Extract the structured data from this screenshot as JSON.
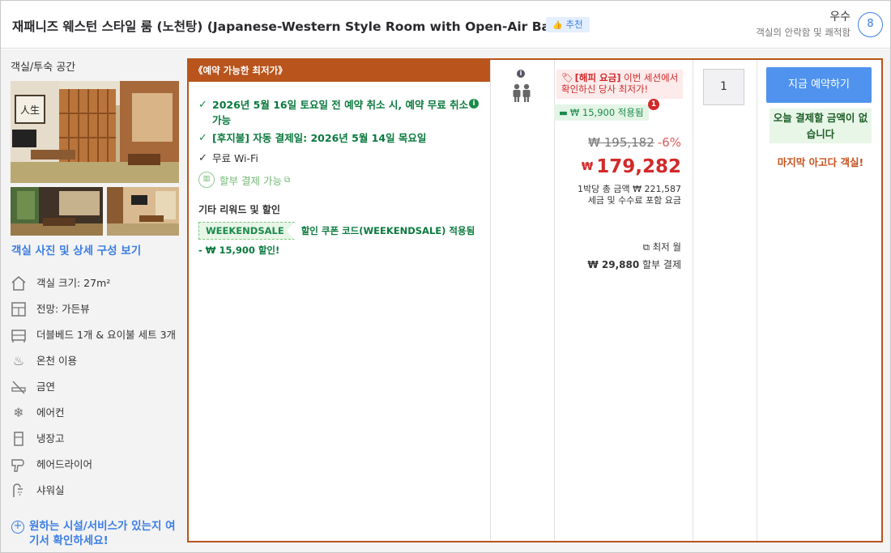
{
  "header": {
    "room_title": "재패니즈 웨스턴 스타일 룸 (노천탕) (Japanese-Western Style Room with Open-Air Bath)",
    "recommend_label": "추천",
    "rating_word": "우수",
    "rating_sub": "객실의 안락함 및 쾌적함",
    "rating_score": "8"
  },
  "left": {
    "heading": "객실/투숙 공간",
    "photos_link": "객실 사진 및 상세 구성 보기",
    "amenities": [
      {
        "icon": "house-icon",
        "label": "객실 크기: 27m²"
      },
      {
        "icon": "window-view-icon",
        "label": "전망: 가든뷰"
      },
      {
        "icon": "bed-icon",
        "label": "더블베드 1개 & 요이불 세트 3개"
      },
      {
        "icon": "hot-spring-icon",
        "label": "온천 이용"
      },
      {
        "icon": "no-smoking-icon",
        "label": "금연"
      },
      {
        "icon": "snowflake-icon",
        "label": "에어컨"
      },
      {
        "icon": "fridge-icon",
        "label": "냉장고"
      },
      {
        "icon": "hair-dryer-icon",
        "label": "헤어드라이어"
      },
      {
        "icon": "shower-icon",
        "label": "샤워실"
      }
    ],
    "more_link": "원하는 시설/서비스가 있는지 여기서 확인하세요!"
  },
  "offer": {
    "banner": "《예약 가능한 최저가》",
    "benefit_1": "2026년 5월 16일 토요일 전 예약 취소 시, 예약 무료 취소 가능",
    "benefit_2": "[후지불] 자동 결제일: 2026년 5월 14일 목요일",
    "benefit_3": "무료 Wi-Fi",
    "installment": "할부 결제 가능",
    "other_title": "기타 리워드 및 할인",
    "coupon_code": "WEEKENDSALE",
    "coupon_text": "할인 쿠폰 코드(WEEKENDSALE) 적용됨",
    "coupon_discount": "- ₩ 15,900 할인!"
  },
  "price": {
    "promo_label": "[해피 요금]",
    "promo_text": "이번 세션에서 확인하신 당사 최저가!",
    "saved": "₩ 15,900 적용됨",
    "saved_badge": "1",
    "original": "₩ 195,182",
    "discount_pct": "-6%",
    "currency": "₩",
    "final": "179,282",
    "per_night": "1박당 총 금액 ₩ 221,587",
    "tax_note": "세금 및 수수료 포함 요금",
    "lowest_monthly": "최저 월",
    "monthly_amount": "₩ 29,880",
    "monthly_suffix": "할부 결제"
  },
  "quantity": "1",
  "action": {
    "book_button": "지금 예약하기",
    "pay_note": "오늘 결제할 금액이 없습니다",
    "last_room": "마지막 아고다 객실!"
  },
  "colors": {
    "accent": "#3b7de3",
    "offer_border": "#b8541c",
    "price_red": "#d12a2a",
    "benefit_green": "#0a7a3e",
    "book_button": "#4f93ee"
  }
}
